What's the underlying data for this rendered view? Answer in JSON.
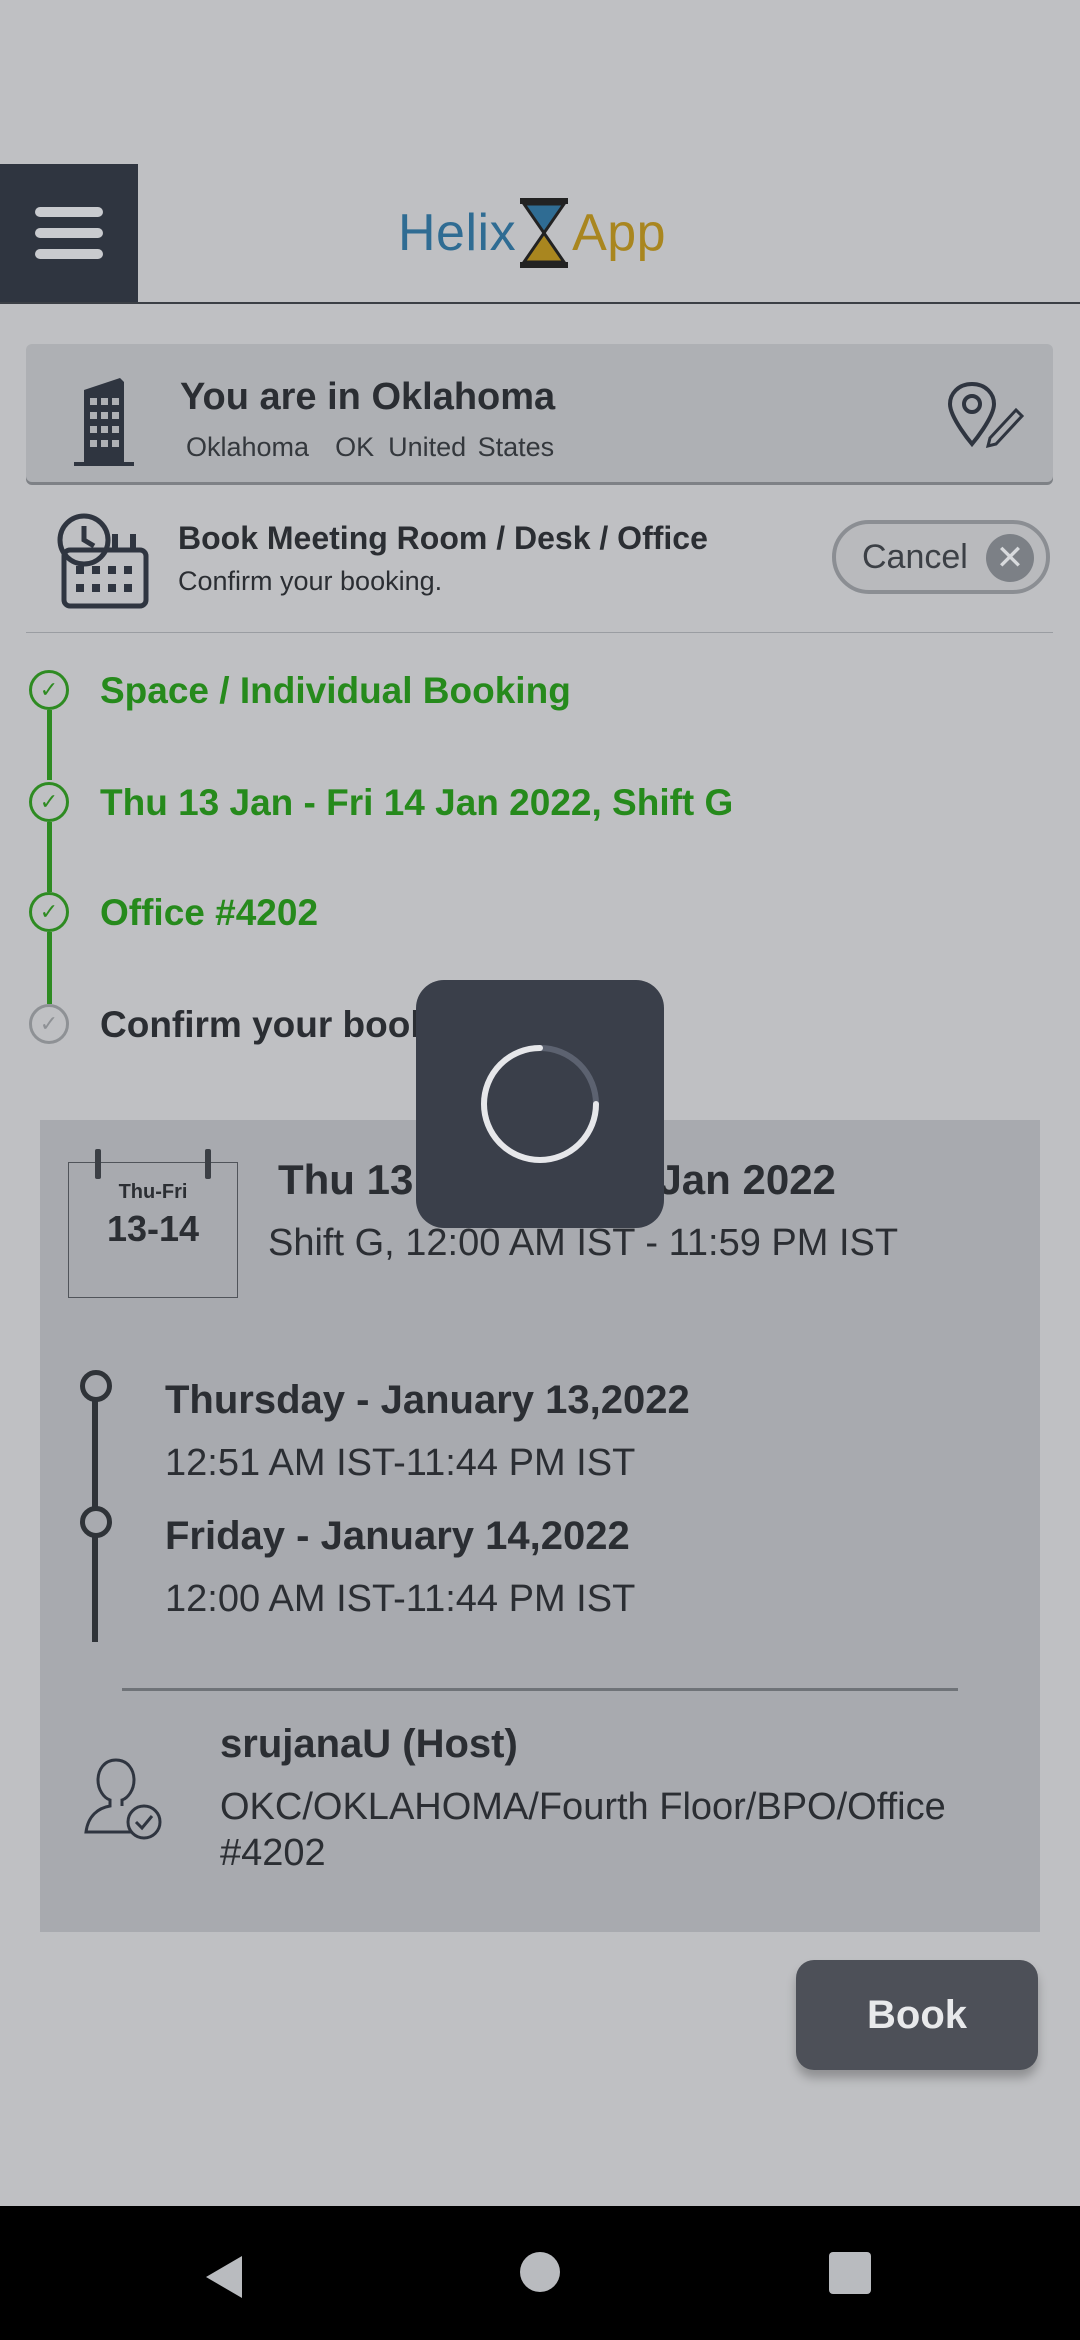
{
  "app": {
    "logo_left": "Helix",
    "logo_right": "App",
    "colors": {
      "primary_dark": "#2f3540",
      "success_green": "#268a1c",
      "logo_blue": "#2f6c93",
      "logo_gold": "#a9861f"
    }
  },
  "location": {
    "title": "You are in Oklahoma",
    "city": "Oklahoma",
    "state": "OK",
    "country": "United States",
    "icons": {
      "building": "building-icon",
      "edit_location": "edit-location-icon"
    }
  },
  "booking_header": {
    "title": "Book Meeting Room / Desk / Office",
    "subtitle": "Confirm your booking.",
    "cancel_label": "Cancel"
  },
  "steps": [
    {
      "label": "Space / Individual Booking",
      "done": true
    },
    {
      "label": "Thu 13 Jan - Fri 14 Jan 2022, Shift G",
      "done": true
    },
    {
      "label": "Office #4202",
      "done": true
    },
    {
      "label": "Confirm your booking",
      "done": false
    }
  ],
  "summary": {
    "cal_days": "Thu-Fri",
    "cal_nums": "13-14",
    "range_title": "Thu 13 Jan - Fri 14 Jan 2022",
    "range_sub": "Shift G, 12:00 AM IST - 11:59 PM IST",
    "days": [
      {
        "title": "Thursday - January 13,2022",
        "time": "12:51 AM IST-11:44 PM IST"
      },
      {
        "title": "Friday - January 14,2022",
        "time": "12:00 AM IST-11:44 PM IST"
      }
    ],
    "host_name": "srujanaU (Host)",
    "host_path": "OKC/OKLAHOMA/Fourth Floor/BPO/Office #4202"
  },
  "book_label": "Book"
}
